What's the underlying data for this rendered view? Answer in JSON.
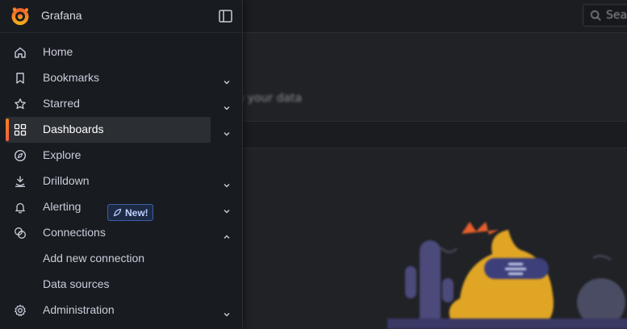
{
  "app": {
    "name": "Grafana"
  },
  "background": {
    "search_placeholder": "Sea",
    "subtitle": "alize your data"
  },
  "menu": {
    "items": [
      {
        "label": "Home",
        "icon": "home-icon",
        "expandable": false
      },
      {
        "label": "Bookmarks",
        "icon": "bookmark-icon",
        "expandable": true,
        "expanded": false
      },
      {
        "label": "Starred",
        "icon": "star-icon",
        "expandable": true,
        "expanded": false
      },
      {
        "label": "Dashboards",
        "icon": "apps-grid-icon",
        "expandable": true,
        "expanded": false,
        "active": true
      },
      {
        "label": "Explore",
        "icon": "compass-icon",
        "expandable": false
      },
      {
        "label": "Drilldown",
        "icon": "drilldown-icon",
        "expandable": true,
        "expanded": false,
        "badge": "New!"
      },
      {
        "label": "Alerting",
        "icon": "bell-icon",
        "expandable": true,
        "expanded": false
      },
      {
        "label": "Connections",
        "icon": "connections-icon",
        "expandable": true,
        "expanded": true,
        "children": [
          {
            "label": "Add new connection"
          },
          {
            "label": "Data sources"
          }
        ]
      },
      {
        "label": "Administration",
        "icon": "gear-icon",
        "expandable": true,
        "expanded": false
      }
    ]
  },
  "colors": {
    "accent_gradient_start": "#f6821f",
    "accent_gradient_end": "#f55f3e",
    "panel_bg": "#181b1f",
    "badge_blue": "#3b5fa8"
  }
}
